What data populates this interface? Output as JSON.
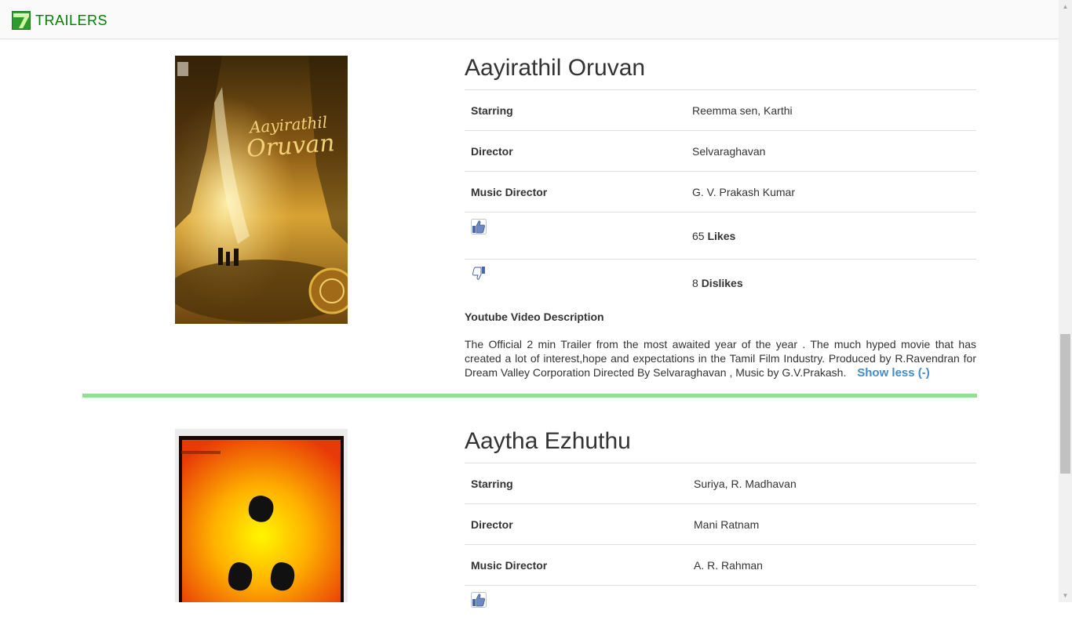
{
  "app": {
    "brand_label": "TRAILERS",
    "brand_color": "#008000"
  },
  "colors": {
    "link": "#428bca",
    "separator": "#90e090",
    "poster2_bg": "#f5f5f5"
  },
  "movies": [
    {
      "title": "Aayirathil Oruvan",
      "starring_label": "Starring",
      "starring": "Reemma sen, Karthi",
      "director_label": "Director",
      "director": "Selvaraghavan",
      "music_label": "Music Director",
      "music": "G. V. Prakash Kumar",
      "likes_count": "65",
      "likes_label": "Likes",
      "dislikes_count": "8",
      "dislikes_label": "Dislikes",
      "description_heading": "Youtube Video Description",
      "description": "The Official 2 min Trailer from the most awaited year of the year . The much hyped movie that has created a lot of interest,hope and expectations in the Tamil Film Industry. Produced by R.Ravendran for Dream Valley Corporation Directed By Selvaraghavan , Music by G.V.Prakash.",
      "show_less_label": "Show less (-)",
      "poster_icon": "movie-poster-golden-cave"
    },
    {
      "title": "Aaytha Ezhuthu",
      "starring_label": "Starring",
      "starring": "Suriya, R. Madhavan",
      "director_label": "Director",
      "director": "Mani Ratnam",
      "music_label": "Music Director",
      "music": "A. R. Rahman",
      "poster_icon": "movie-poster-orange-three-dots"
    }
  ],
  "icons": {
    "like": "thumbs-up-icon",
    "dislike": "thumbs-down-icon"
  }
}
